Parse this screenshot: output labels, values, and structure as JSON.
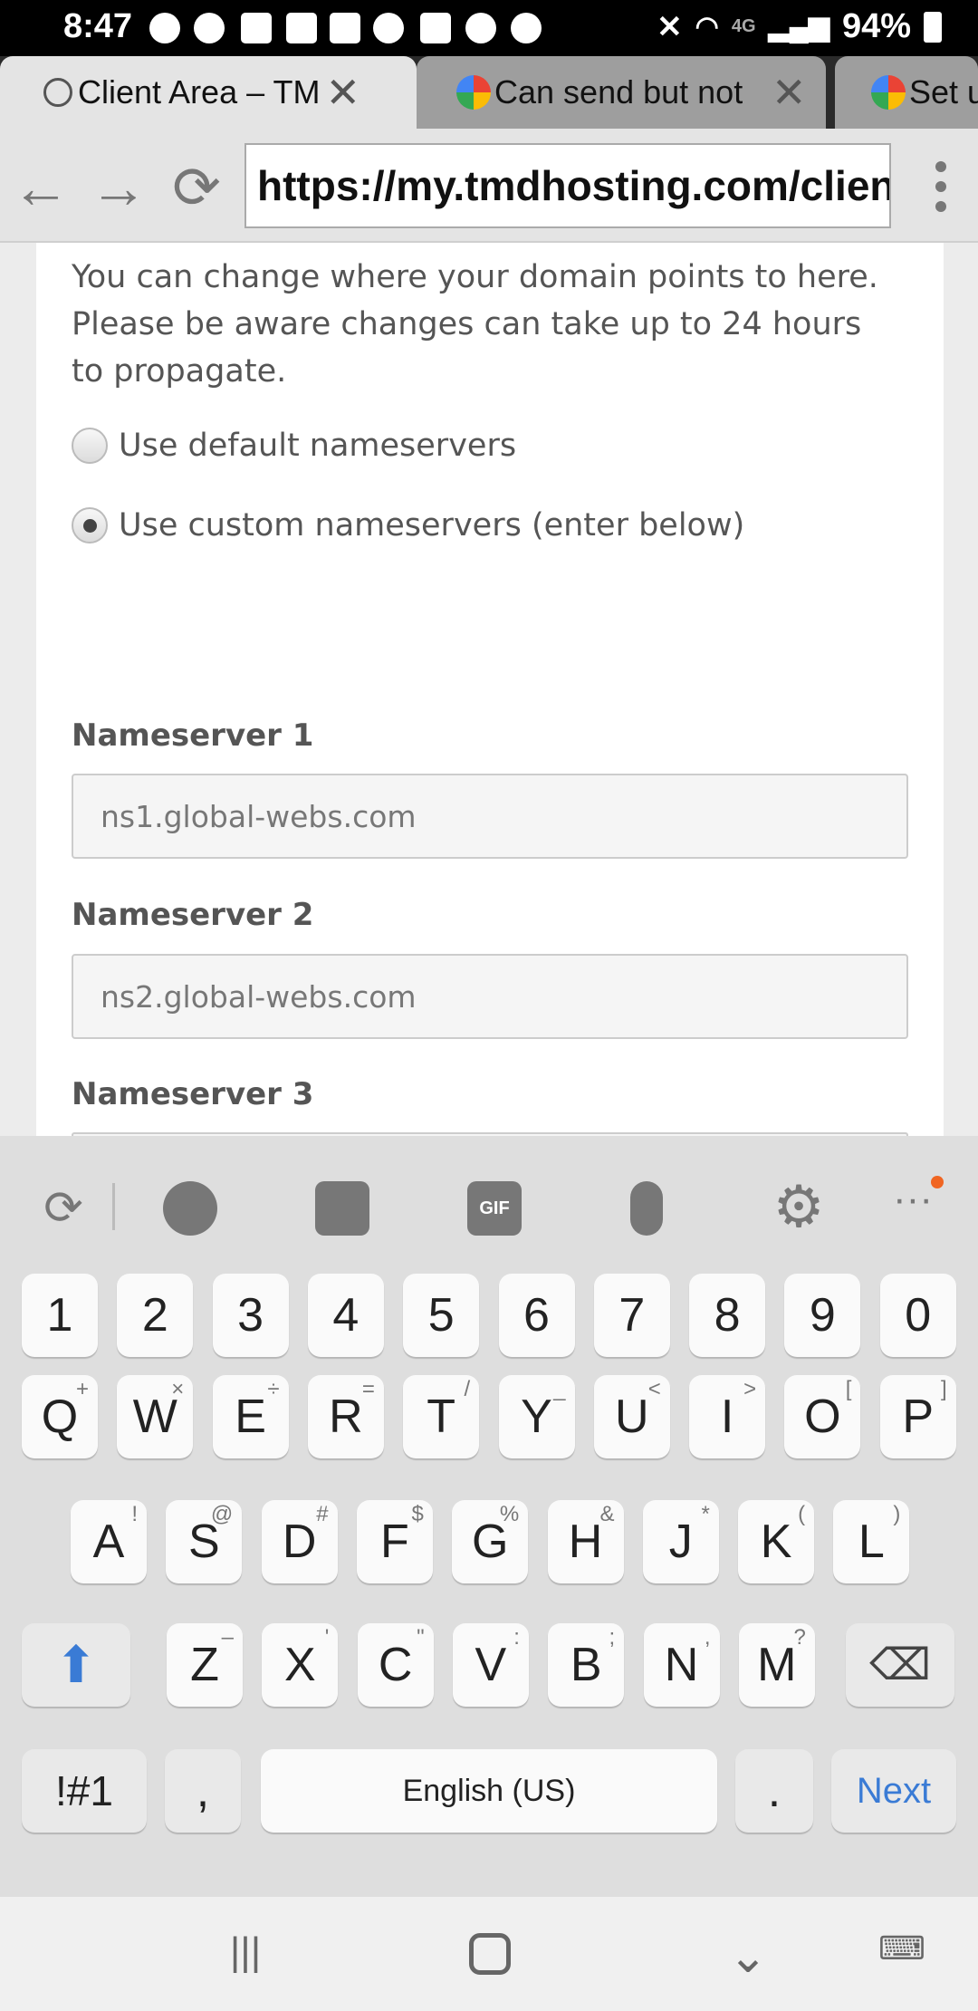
{
  "status_bar": {
    "time": "8:47",
    "network": "4G",
    "battery": "94%"
  },
  "tabs": [
    {
      "label": "Client Area – TM",
      "icon": "globe-icon",
      "active": true
    },
    {
      "label": "Can send but not",
      "icon": "google-icon",
      "active": false
    },
    {
      "label": "Set u",
      "icon": "google-icon",
      "active": false
    }
  ],
  "toolbar": {
    "url": "https://my.tmdhosting.com/clientarea"
  },
  "page": {
    "description": "You can change where your domain points to here. Please be aware changes can take up to 24 hours to propagate.",
    "radio_default": "Use default nameservers",
    "radio_custom": "Use custom nameservers (enter below)",
    "ns1_label": "Nameserver 1",
    "ns1_value": "ns1.global-webs.com",
    "ns2_label": "Nameserver 2",
    "ns2_value": "ns2.global-webs.com",
    "ns3_label": "Nameserver 3"
  },
  "keyboard": {
    "row_numbers": [
      "1",
      "2",
      "3",
      "4",
      "5",
      "6",
      "7",
      "8",
      "9",
      "0"
    ],
    "row_q": [
      [
        "Q",
        "+"
      ],
      [
        "W",
        "×"
      ],
      [
        "E",
        "÷"
      ],
      [
        "R",
        "="
      ],
      [
        "T",
        "/"
      ],
      [
        "Y",
        "_"
      ],
      [
        "U",
        "<"
      ],
      [
        "I",
        ">"
      ],
      [
        "O",
        "["
      ],
      [
        "P",
        "]"
      ]
    ],
    "row_a": [
      [
        "A",
        "!"
      ],
      [
        "S",
        "@"
      ],
      [
        "D",
        "#"
      ],
      [
        "F",
        "$"
      ],
      [
        "G",
        "%"
      ],
      [
        "H",
        "&"
      ],
      [
        "J",
        "*"
      ],
      [
        "K",
        "("
      ],
      [
        "L",
        ")"
      ]
    ],
    "row_z": [
      [
        "Z",
        "–"
      ],
      [
        "X",
        "'"
      ],
      [
        "C",
        "\""
      ],
      [
        "V",
        ":"
      ],
      [
        "B",
        ";"
      ],
      [
        "N",
        ","
      ],
      [
        "M",
        "?"
      ]
    ],
    "symbols_key": "!#1",
    "comma_key": ",",
    "space_key": "English (US)",
    "period_key": ".",
    "next_key": "Next"
  }
}
